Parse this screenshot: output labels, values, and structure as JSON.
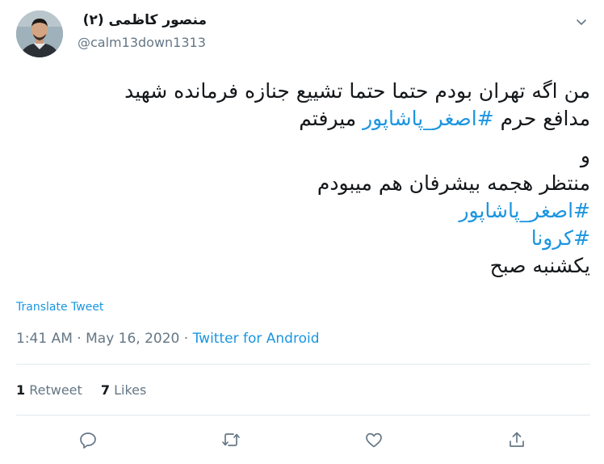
{
  "user": {
    "display_name": "منصور کاظمی (۲)",
    "handle": "@calm13down1313"
  },
  "tweet": {
    "lines": [
      [
        {
          "text": "من اگه تهران بودم حتما حتما تشییع جنازه فرمانده شهید"
        }
      ],
      [
        {
          "text": "مدافع حرم "
        },
        {
          "text": "#اصغر_پاشاپور",
          "hashtag": true
        },
        {
          "text": " میرفتم"
        }
      ],
      [
        {
          "text": "و"
        }
      ],
      [
        {
          "text": "منتظر هجمه بیشرفان هم میبودم"
        }
      ],
      [
        {
          "text": "#اصغر_پاشاپور",
          "hashtag": true
        }
      ],
      [
        {
          "text": "#کرونا",
          "hashtag": true
        }
      ],
      [
        {
          "text": "یکشنبه صبح"
        }
      ]
    ]
  },
  "translate_label": "Translate Tweet",
  "meta": {
    "time": "1:41 AM",
    "separator": "·",
    "date": "May 16, 2020",
    "source": "Twitter for Android"
  },
  "stats": {
    "retweets_count": "1",
    "retweets_label": "Retweet",
    "likes_count": "7",
    "likes_label": "Likes"
  },
  "colors": {
    "link": "#1b95e0",
    "secondary_text": "#657786",
    "divider": "#e1e8ed"
  },
  "icons": [
    "chevron-down-icon",
    "reply-icon",
    "retweet-icon",
    "like-icon",
    "share-icon"
  ]
}
